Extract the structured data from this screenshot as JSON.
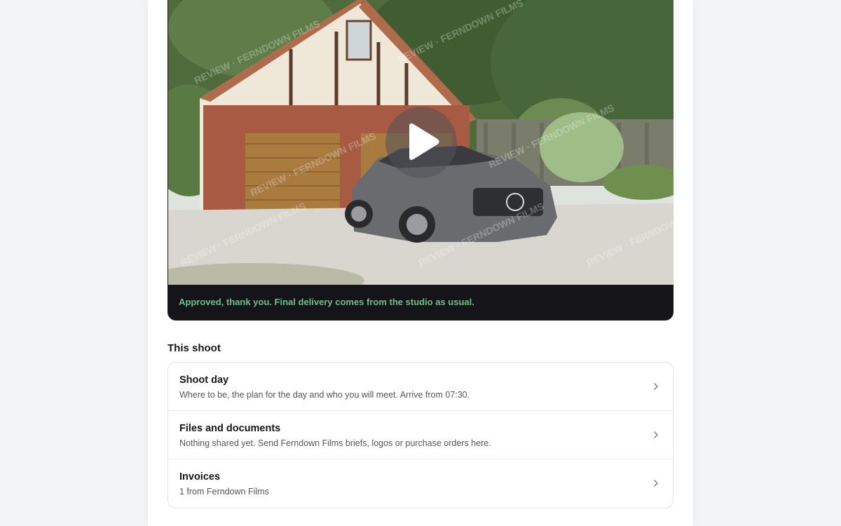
{
  "video": {
    "caption": "Approved, thank you. Final delivery comes from the studio as usual.",
    "play_icon": "play-icon",
    "watermark": "REVIEW · FERNDOWN FILMS"
  },
  "section": {
    "title": "This shoot"
  },
  "items": [
    {
      "title": "Shoot day",
      "description": "Where to be, the plan for the day and who you will meet. Arrive from 07:30.",
      "icon": "chevron-right-icon"
    },
    {
      "title": "Files and documents",
      "description": "Nothing shared yet. Send Ferndown Films briefs, logos or purchase orders here.",
      "icon": "chevron-right-icon"
    },
    {
      "title": "Invoices",
      "description": "1 from Ferndown Films",
      "icon": "chevron-right-icon"
    }
  ],
  "colors": {
    "caption_green": "#6fbf86",
    "video_bar": "#141419",
    "page_bg": "#f3f4f6"
  }
}
